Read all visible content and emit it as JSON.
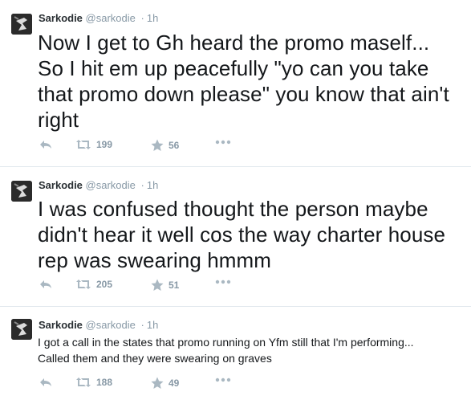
{
  "tweets": [
    {
      "name": "Sarkodie",
      "handle": "@sarkodie",
      "separator": "·",
      "time": "1h",
      "text": "Now I get to Gh heard the promo maself... So I hit em up peacefully \"yo can you take that promo down please\" you know that ain't right",
      "retweets": "199",
      "favorites": "56"
    },
    {
      "name": "Sarkodie",
      "handle": "@sarkodie",
      "separator": "·",
      "time": "1h",
      "text": "I was confused thought the person maybe didn't hear it well cos the way charter house rep was swearing hmmm",
      "retweets": "205",
      "favorites": "51"
    },
    {
      "name": "Sarkodie",
      "handle": "@sarkodie",
      "separator": "·",
      "time": "1h",
      "text": "I got a call in the states that promo running on Yfm still that I'm performing... Called them and they were swearing on graves",
      "retweets": "188",
      "favorites": "49"
    }
  ],
  "icons": {
    "reply": "reply-icon",
    "retweet": "retweet-icon",
    "favorite": "star-icon",
    "more": "more-icon"
  },
  "colors": {
    "icon": "#aab8c2",
    "muted": "#8899a6",
    "divider": "#e1e8ed"
  }
}
